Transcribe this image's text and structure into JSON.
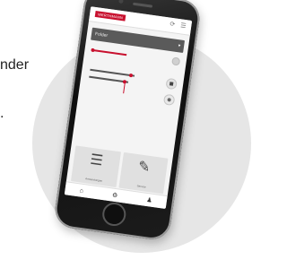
{
  "side_text": {
    "line1": "nder",
    "line2": "."
  },
  "app": {
    "logo_text": "WERTHMANN",
    "accent_color": "#c8102e",
    "dropdown_value": "Folder",
    "dropdown_caret": "▾",
    "tiles": [
      {
        "icon": "list-icon",
        "glyph": "☰",
        "caption": "Anwendungen"
      },
      {
        "icon": "wrench-icon",
        "glyph": "✎",
        "caption": "Service"
      }
    ],
    "nav_icons": [
      "home-icon",
      "settings-icon",
      "user-icon"
    ]
  },
  "icons": {
    "menu": "☰",
    "refresh": "⟳",
    "home": "⌂",
    "settings": "⚙",
    "user": "♟"
  }
}
